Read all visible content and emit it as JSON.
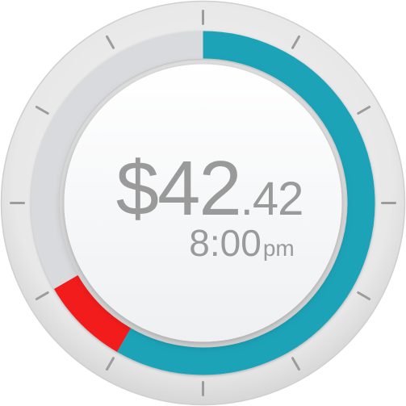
{
  "display": {
    "amount_main": "$42",
    "amount_cents": ".42",
    "time": "8:00",
    "time_suffix": "pm"
  },
  "dial": {
    "tick_count": 12,
    "segments": [
      {
        "name": "blue",
        "color": "#1ea3b8",
        "start_fraction": 0.0,
        "end_fraction": 0.5833
      },
      {
        "name": "red",
        "color": "#f21a1a",
        "start_fraction": 0.5833,
        "end_fraction": 0.6667
      }
    ],
    "track_color": "#d8dadd",
    "bezel_color": "#e6e6e6",
    "tick_color": "#9c9c9c"
  }
}
